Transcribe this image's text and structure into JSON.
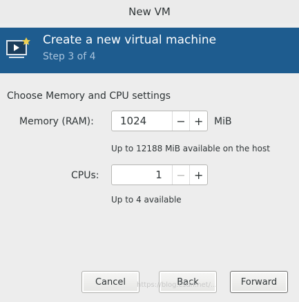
{
  "window": {
    "title": "New VM"
  },
  "banner": {
    "title": "Create a new virtual machine",
    "step": "Step 3 of 4",
    "icon": "vm-monitor-icon",
    "color": "#1e5c8f"
  },
  "section": {
    "heading": "Choose Memory and CPU settings"
  },
  "memory": {
    "label": "Memory (RAM):",
    "value": "1024",
    "minus": "−",
    "plus": "+",
    "unit": "MiB",
    "hint": "Up to 12188 MiB available on the host"
  },
  "cpus": {
    "label": "CPUs:",
    "value": "1",
    "minus": "−",
    "plus": "+",
    "hint": "Up to 4 available"
  },
  "footer": {
    "cancel": "Cancel",
    "back": "Back",
    "forward": "Forward"
  },
  "watermark": "https://blog.csdn.net/..."
}
